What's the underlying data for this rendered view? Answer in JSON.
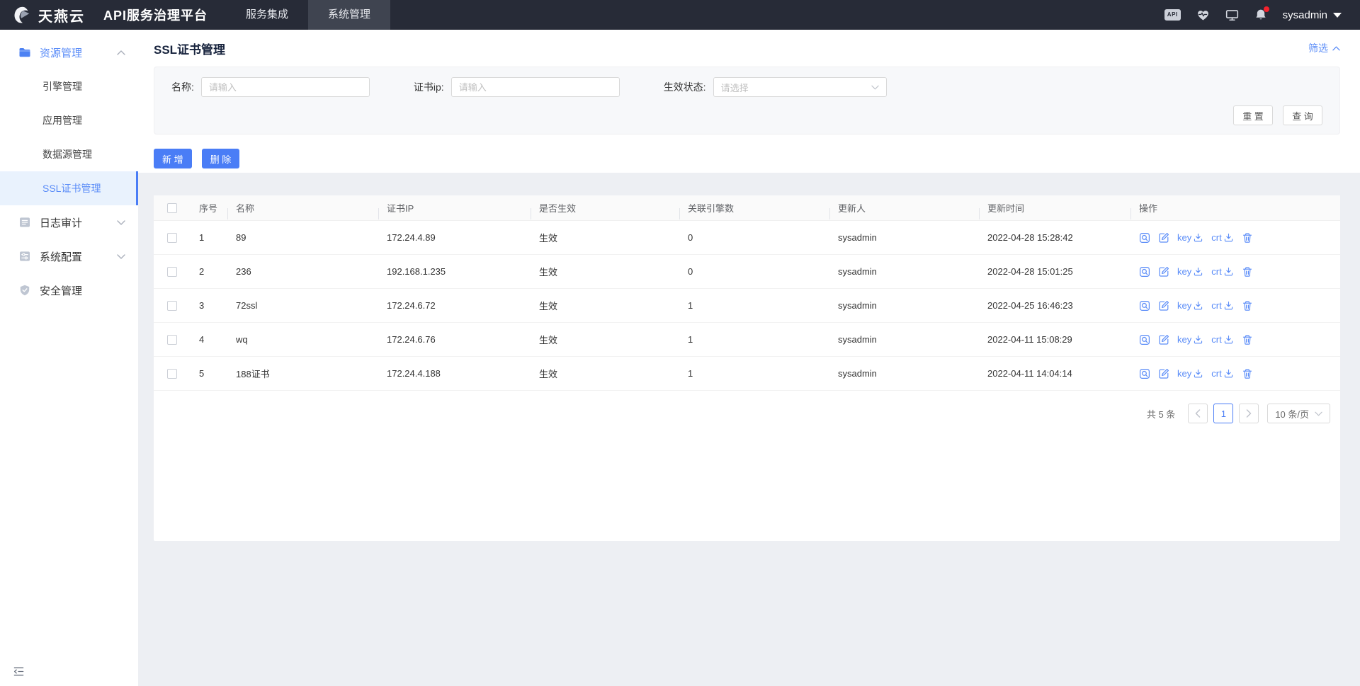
{
  "colors": {
    "primary": "#4a7df6",
    "link_blue": "#5a8cf8",
    "nav_bg": "#272b37",
    "notification_dot": "#f5222d",
    "active_menu_bg": "#e9f2fd"
  },
  "nav": {
    "logo_text": "天燕云",
    "platform_title": "API服务治理平台",
    "tabs": [
      {
        "label": "服务集成",
        "active": false
      },
      {
        "label": "系统管理",
        "active": true
      }
    ],
    "icons": [
      "api-badge",
      "health-monitor",
      "screen-monitor",
      "notification-bell"
    ],
    "api_badge_text": "API",
    "user": "sysadmin"
  },
  "sidebar": {
    "groups": [
      {
        "label": "资源管理",
        "icon": "folder",
        "expanded": true,
        "children": [
          {
            "label": "引擎管理",
            "active": false
          },
          {
            "label": "应用管理",
            "active": false
          },
          {
            "label": "数据源管理",
            "active": false
          },
          {
            "label": "SSL证书管理",
            "active": true
          }
        ]
      },
      {
        "label": "日志审计",
        "icon": "log-list",
        "expanded": false
      },
      {
        "label": "系统配置",
        "icon": "config-sliders",
        "expanded": false
      },
      {
        "label": "安全管理",
        "icon": "shield",
        "expanded": false
      }
    ]
  },
  "page": {
    "title": "SSL证书管理",
    "filter_toggle_label": "筛选",
    "filters": [
      {
        "label": "名称:",
        "placeholder": "请输入",
        "type": "input"
      },
      {
        "label": "证书ip:",
        "placeholder": "请输入",
        "type": "input"
      },
      {
        "label": "生效状态:",
        "placeholder": "请选择",
        "type": "select"
      }
    ],
    "filter_buttons": {
      "reset": "重 置",
      "search": "查 询"
    },
    "toolbar": {
      "add": "新 增",
      "delete": "删 除"
    },
    "table": {
      "columns": [
        "序号",
        "名称",
        "证书IP",
        "是否生效",
        "关联引擎数",
        "更新人",
        "更新时间",
        "操作"
      ],
      "row_actions": {
        "key_label": "key",
        "crt_label": "crt"
      },
      "rows": [
        {
          "no": "1",
          "name": "89",
          "ip": "172.24.4.89",
          "status": "生效",
          "engines": "0",
          "updater": "sysadmin",
          "time": "2022-04-28 15:28:42"
        },
        {
          "no": "2",
          "name": "236",
          "ip": "192.168.1.235",
          "status": "生效",
          "engines": "0",
          "updater": "sysadmin",
          "time": "2022-04-28 15:01:25"
        },
        {
          "no": "3",
          "name": "72ssl",
          "ip": "172.24.6.72",
          "status": "生效",
          "engines": "1",
          "updater": "sysadmin",
          "time": "2022-04-25 16:46:23"
        },
        {
          "no": "4",
          "name": "wq",
          "ip": "172.24.6.76",
          "status": "生效",
          "engines": "1",
          "updater": "sysadmin",
          "time": "2022-04-11 15:08:29"
        },
        {
          "no": "5",
          "name": "188证书",
          "ip": "172.24.4.188",
          "status": "生效",
          "engines": "1",
          "updater": "sysadmin",
          "time": "2022-04-11 14:04:14"
        }
      ]
    },
    "pagination": {
      "total": "共 5 条",
      "current": "1",
      "page_size": "10 条/页"
    }
  }
}
